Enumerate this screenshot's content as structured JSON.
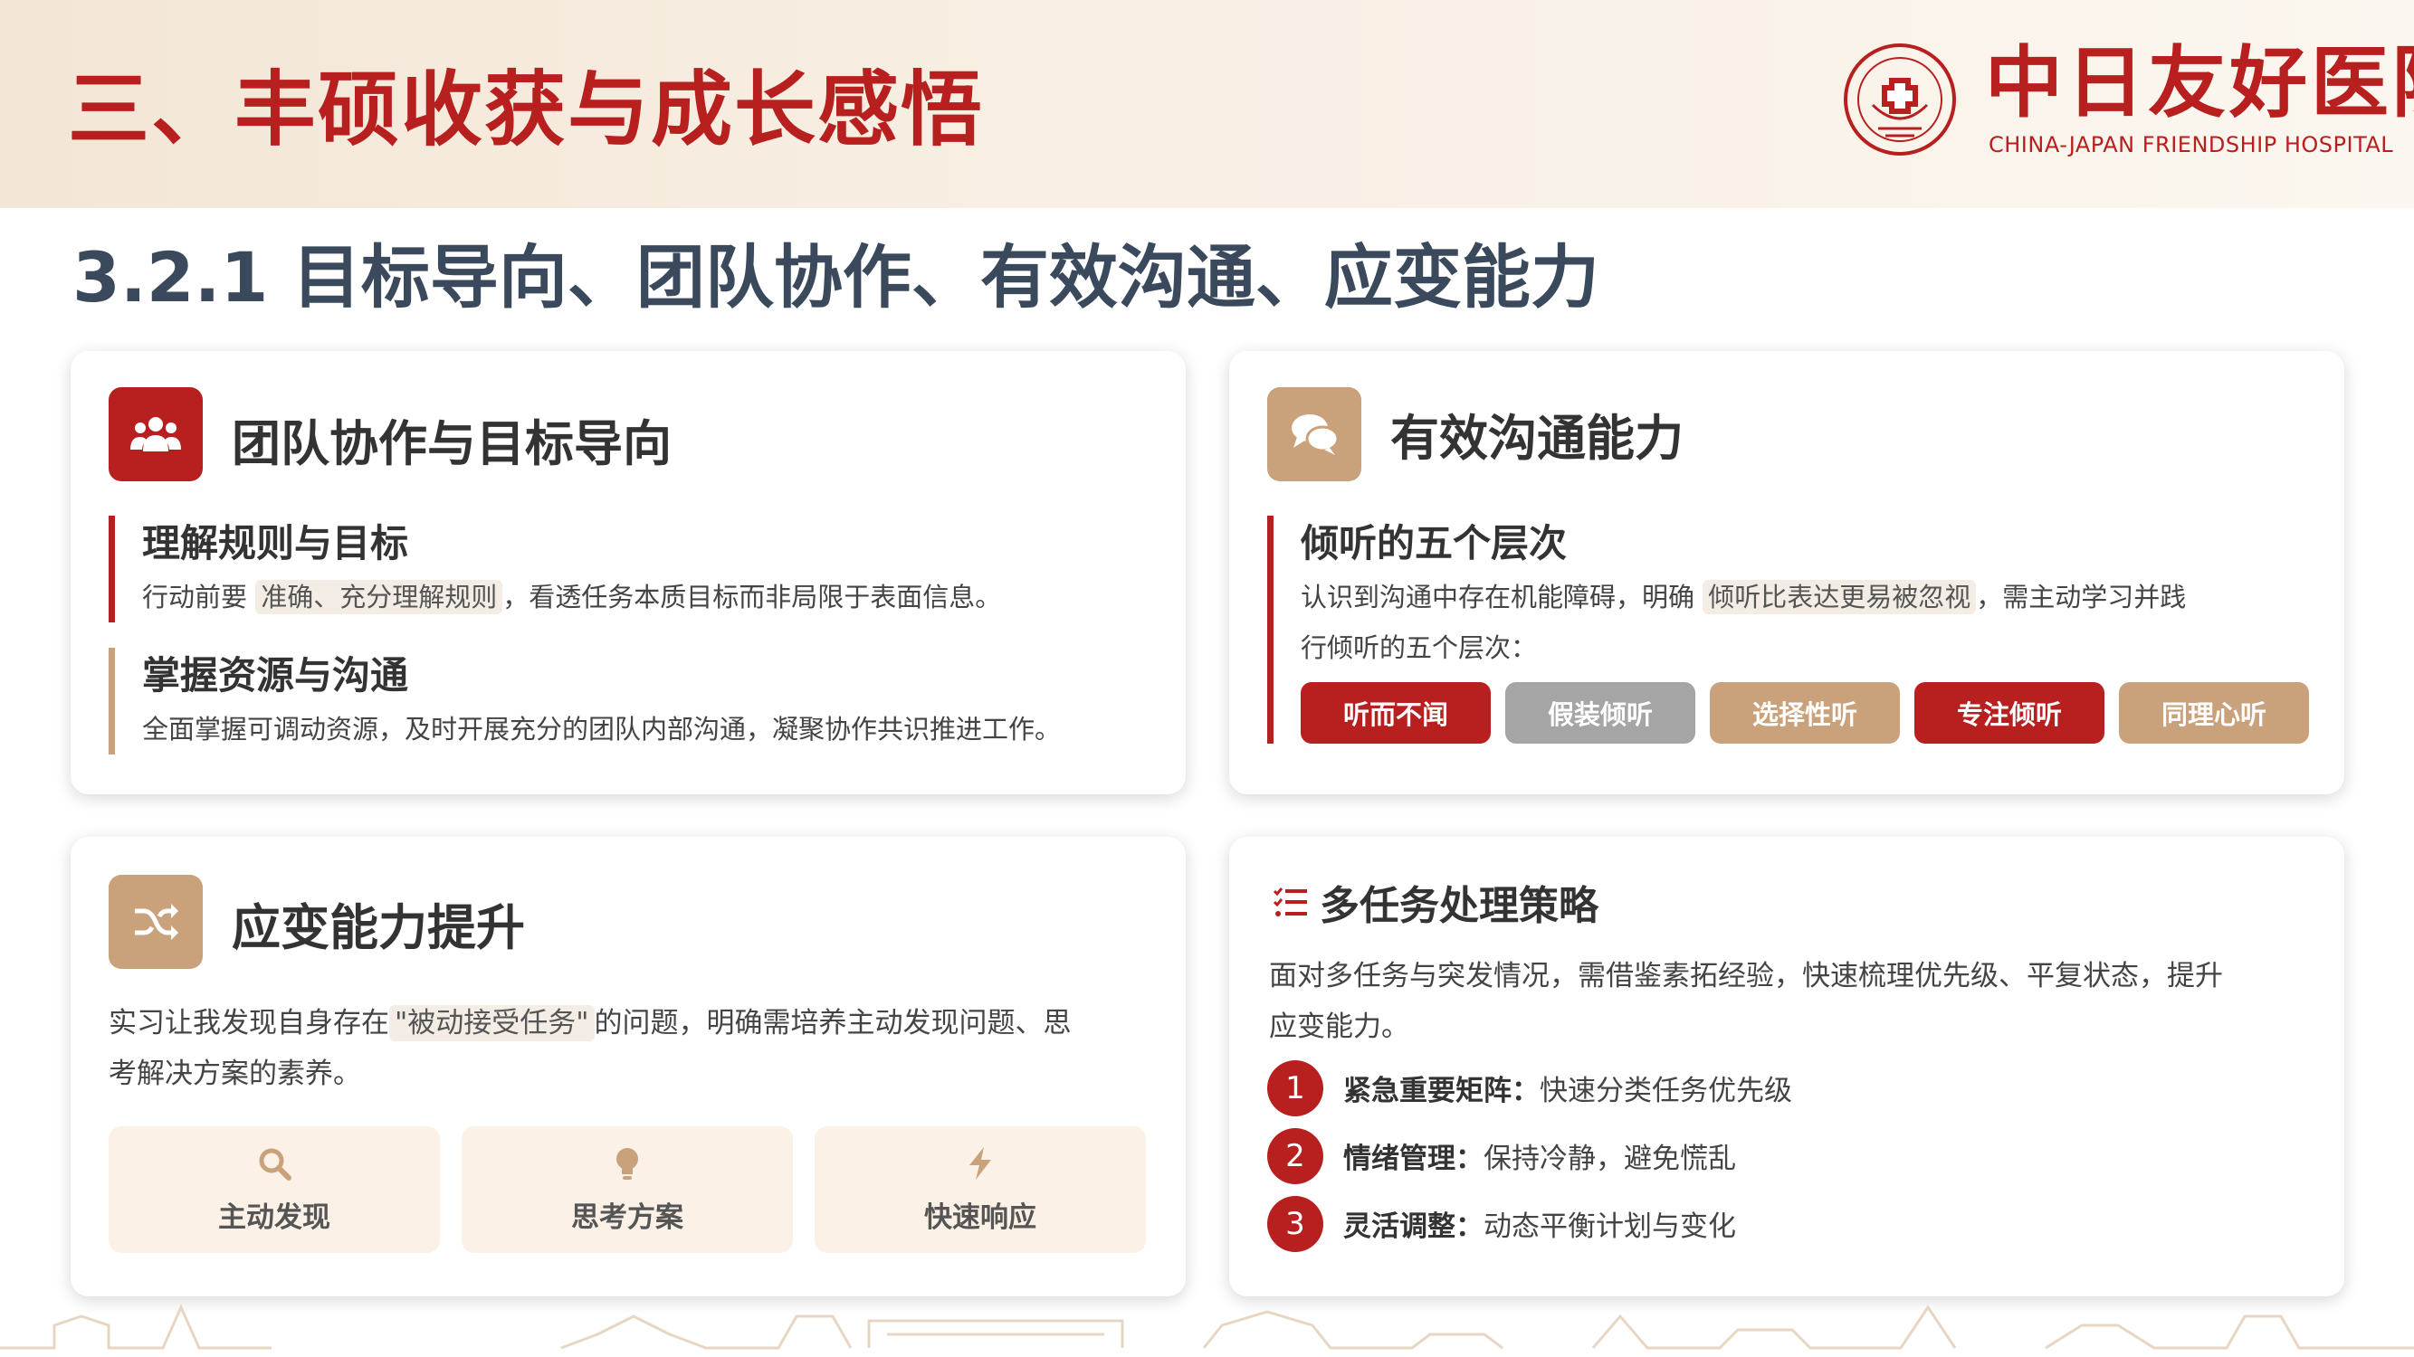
{
  "header": {
    "title": "三、丰硕收获与成长感悟",
    "logo_cn": "中日友好医院",
    "logo_en": "CHINA-JAPAN FRIENDSHIP HOSPITAL",
    "seal_text": "中日友好医院"
  },
  "subtitle": "3.2.1 目标导向、团队协作、有效沟通、应变能力",
  "colors": {
    "accent_red": "#b8201f",
    "accent_tan": "#c9a27c",
    "gray": "#a5a5a5",
    "heading": "#3a4a5c"
  },
  "card1": {
    "icon": "users-icon",
    "title": "团队协作与目标导向",
    "blocks": [
      {
        "title": "理解规则与目标",
        "text_a": "行动前要",
        "highlight": "准确、充分理解规则",
        "text_b": "，看透任务本质目标而非局限于表面信息。"
      },
      {
        "title": "掌握资源与沟通",
        "text": "全面掌握可调动资源，及时开展充分的团队内部沟通，凝聚协作共识推进工作。"
      }
    ]
  },
  "card2": {
    "icon": "chat-icon",
    "title": "有效沟通能力",
    "block_title": "倾听的五个层次",
    "line1_a": "认识到沟通中存在机能障碍，明确",
    "highlight": "倾听比表达更易被忽视",
    "line1_b": "，需主动学习并践",
    "line2": "行倾听的五个层次：",
    "levels": [
      "听而不闻",
      "假装倾听",
      "选择性听",
      "专注倾听",
      "同理心听"
    ]
  },
  "card3": {
    "icon": "shuffle-icon",
    "title": "应变能力提升",
    "line1_a": "实习让我发现自身存在",
    "highlight": "\"被动接受任务\"",
    "line1_b": "的问题，明确需培养主动发现问题、思",
    "line2": "考解决方案的素养。",
    "features": [
      {
        "icon": "search-icon",
        "label": "主动发现"
      },
      {
        "icon": "lightbulb-icon",
        "label": "思考方案"
      },
      {
        "icon": "bolt-icon",
        "label": "快速响应"
      }
    ]
  },
  "card4": {
    "icon": "list-icon",
    "title": "多任务处理策略",
    "line1": "面对多任务与突发情况，需借鉴素拓经验，快速梳理优先级、平复状态，提升",
    "line2": "应变能力。",
    "items": [
      {
        "num": "1",
        "title": "紧急重要矩阵：",
        "desc": "快速分类任务优先级"
      },
      {
        "num": "2",
        "title": "情绪管理：",
        "desc": "保持冷静，避免慌乱"
      },
      {
        "num": "3",
        "title": "灵活调整：",
        "desc": "动态平衡计划与变化"
      }
    ]
  }
}
